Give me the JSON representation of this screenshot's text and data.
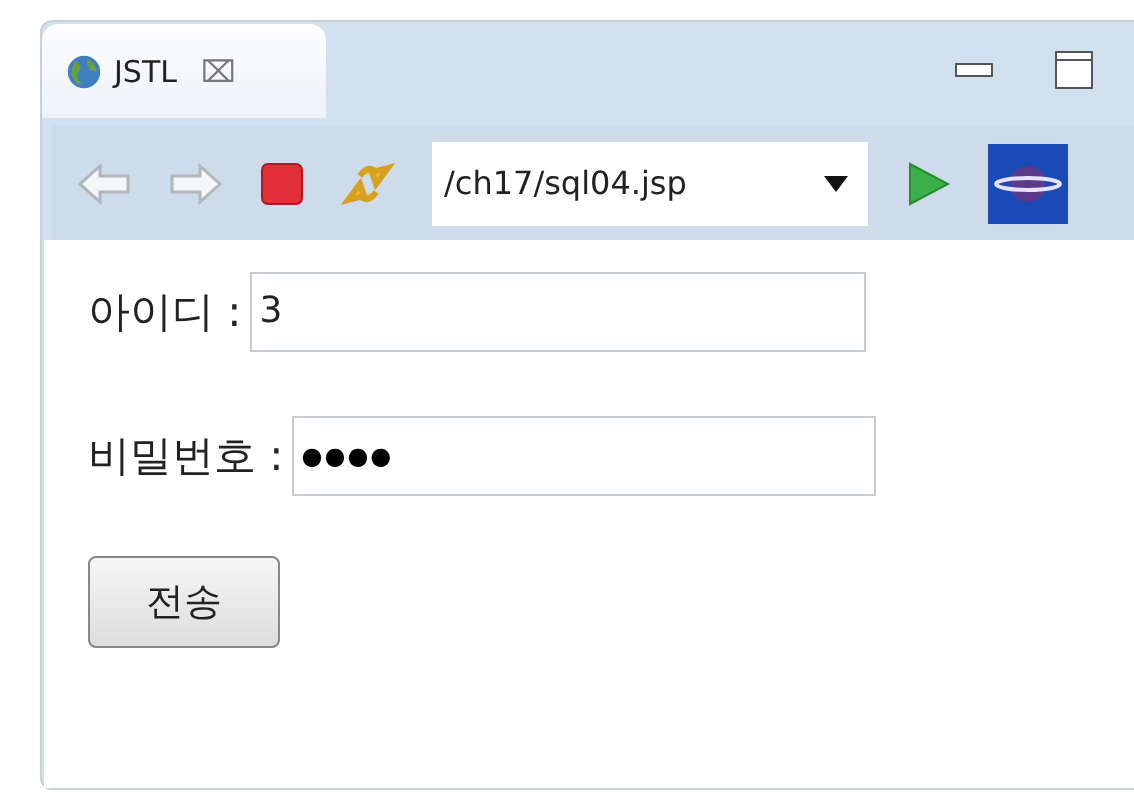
{
  "tab": {
    "title": "JSTL",
    "close": "⌧"
  },
  "toolbar": {
    "url": "/ch17/sql04.jsp"
  },
  "form": {
    "fields": [
      {
        "label": "아이디 :",
        "value": "3",
        "kind": "text"
      },
      {
        "label": "비밀번호 :",
        "value": "●●●●",
        "kind": "password"
      }
    ],
    "submit": "전송"
  }
}
